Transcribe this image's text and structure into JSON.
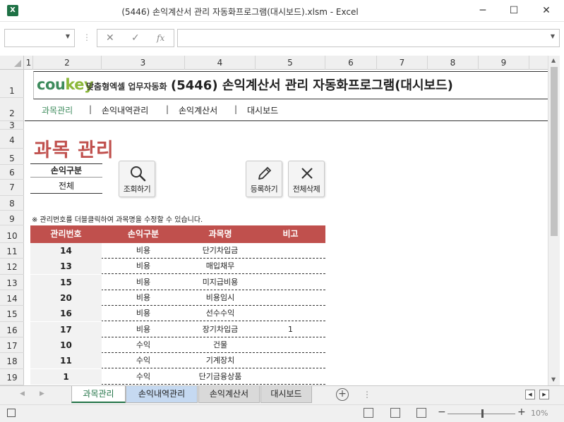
{
  "window": {
    "title": "(5446) 손익계산서 관리 자동화프로그램(대시보드).xlsm - Excel",
    "app_icon": "X",
    "minimize": "─",
    "maximize": "☐",
    "close": "✕"
  },
  "formula_bar": {
    "cancel": "✕",
    "enter": "✓",
    "fx": "fx",
    "value": ""
  },
  "columns": [
    "1",
    "2",
    "3",
    "4",
    "5",
    "6",
    "7",
    "8",
    "9"
  ],
  "rows": [
    "1",
    "2",
    "3",
    "4",
    "5",
    "6",
    "7",
    "8",
    "9",
    "10",
    "11",
    "12",
    "13",
    "14",
    "15",
    "16",
    "17",
    "18",
    "19"
  ],
  "banner": {
    "logo_a": "cou",
    "logo_b": "key",
    "logo_sub": "맞춤형엑셀 업무자동화",
    "title": "(5446) 손익계산서 관리 자동화프로그램(대시보드)"
  },
  "nav": {
    "items": [
      "과목관리",
      "손익내역관리",
      "손익계산서",
      "대시보드"
    ],
    "separator": "|",
    "active_color": "#3d8b5c"
  },
  "section_title": "과목 관리",
  "filter": {
    "label": "손익구분",
    "value": "전체"
  },
  "buttons": {
    "search": "조회하기",
    "register": "등록하기",
    "delete_all": "전체삭제"
  },
  "note": "※ 관리번호를 더블클릭하여 과목명을 수정할 수 있습니다.",
  "table": {
    "header_color": "#c0504d",
    "headers": [
      "관리번호",
      "손익구분",
      "과목명",
      "비고"
    ],
    "rows": [
      [
        "14",
        "비용",
        "단기차입금",
        ""
      ],
      [
        "13",
        "비용",
        "매입채무",
        ""
      ],
      [
        "15",
        "비용",
        "미지급비용",
        ""
      ],
      [
        "20",
        "비용",
        "비용임시",
        ""
      ],
      [
        "16",
        "비용",
        "선수수익",
        ""
      ],
      [
        "17",
        "비용",
        "장기차입금",
        "1"
      ],
      [
        "10",
        "수익",
        "건물",
        ""
      ],
      [
        "11",
        "수익",
        "기계장치",
        ""
      ],
      [
        "1",
        "수익",
        "단기금융상품",
        ""
      ]
    ]
  },
  "sheet_tabs": [
    {
      "label": "과목관리",
      "active": true
    },
    {
      "label": "손익내역관리",
      "active": false
    },
    {
      "label": "손익계산서",
      "active": false
    },
    {
      "label": "대시보드",
      "active": false
    }
  ],
  "tab_colors": [
    "#ffffff",
    "#c5d9f1",
    "#d9d9d9",
    "#d9d9d9"
  ],
  "tab_add": "+",
  "status": {
    "zoom_minus": "−",
    "zoom_plus": "+",
    "zoom": "10%"
  }
}
